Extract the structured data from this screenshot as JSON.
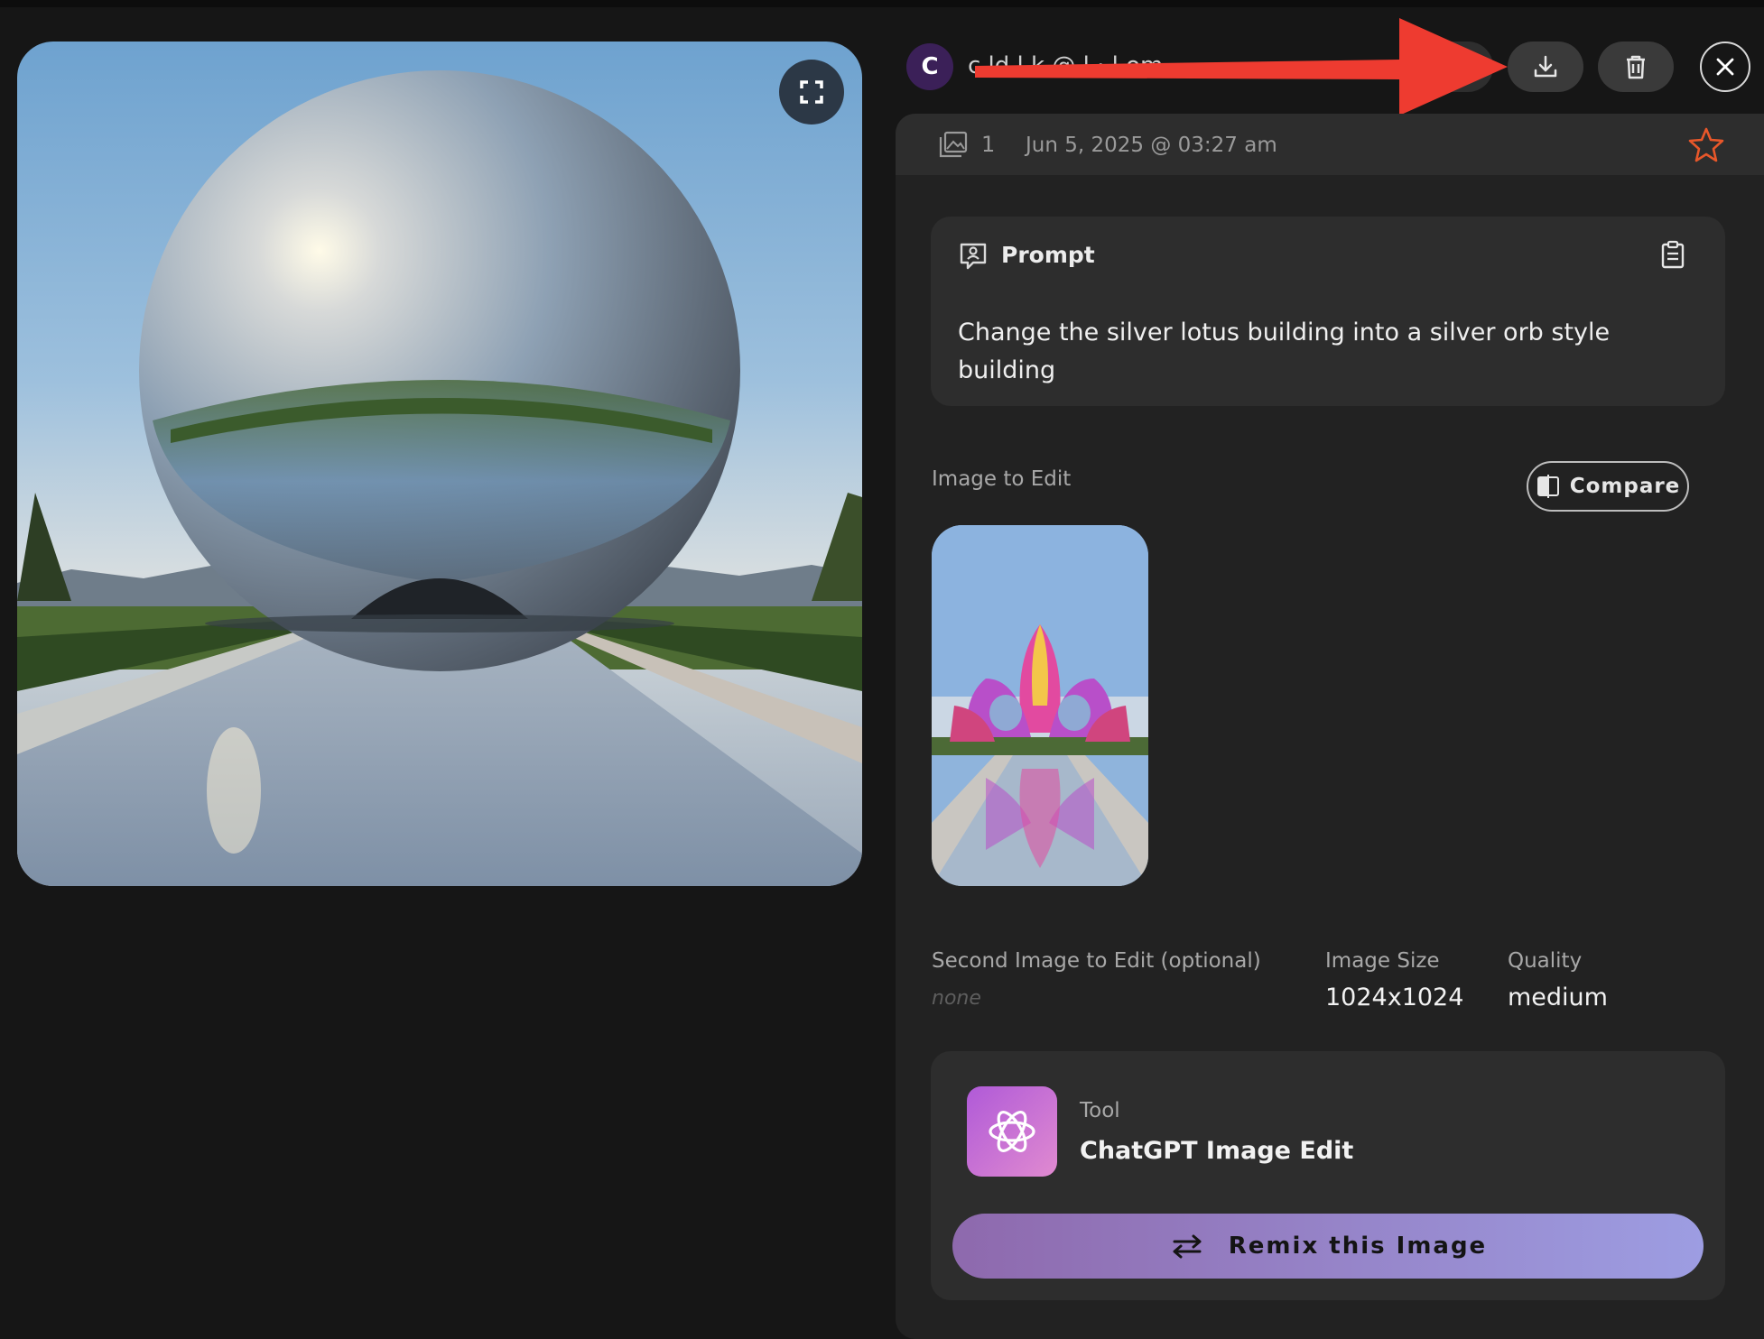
{
  "header": {
    "avatar_initial": "C",
    "creator_name": "c     ld   l      k    @       l   ·  l  om"
  },
  "details": {
    "image_count": "1",
    "date": "Jun 5, 2025 @ 03:27 am"
  },
  "prompt": {
    "title": "Prompt",
    "text": "Change the silver lotus building into a silver orb style building"
  },
  "image_to_edit": {
    "label": "Image to Edit",
    "compare_label": "Compare"
  },
  "second_image": {
    "label": "Second Image to Edit (optional)",
    "value": "none"
  },
  "image_size": {
    "label": "Image Size",
    "value": "1024x1024"
  },
  "quality": {
    "label": "Quality",
    "value": "medium"
  },
  "tool": {
    "label": "Tool",
    "name": "ChatGPT Image Edit"
  },
  "remix": {
    "label": "Remix this Image"
  },
  "colors": {
    "background": "#161616",
    "panel": "#222222",
    "card": "#2d2d2d",
    "star": "#e8572a",
    "annotation_arrow": "#ee3b30",
    "remix_gradient_start": "#8e69ad",
    "remix_gradient_end": "#9d9de2"
  },
  "icons": [
    "expand-icon",
    "download-icon",
    "trash-icon",
    "close-icon",
    "gallery-icon",
    "star-icon",
    "prompt-icon",
    "clipboard-icon",
    "compare-icon",
    "openai-icon",
    "swap-arrows-icon"
  ]
}
